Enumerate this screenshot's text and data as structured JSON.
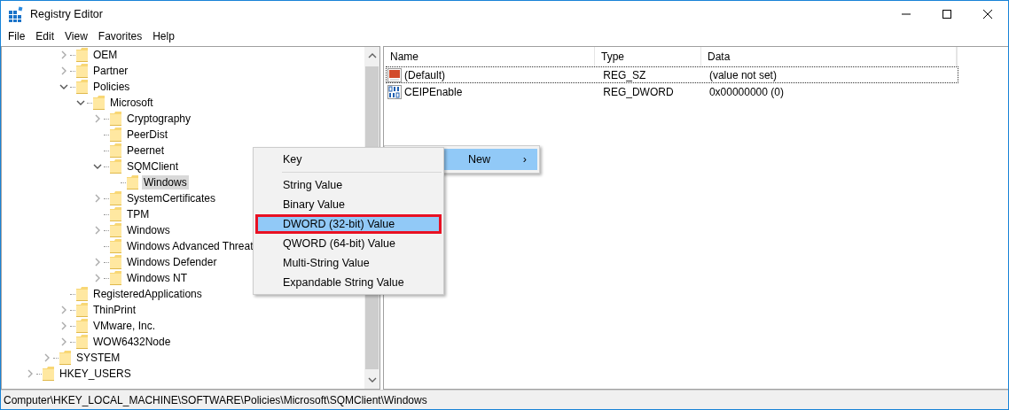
{
  "window": {
    "title": "Registry Editor"
  },
  "menu_bar": [
    "File",
    "Edit",
    "View",
    "Favorites",
    "Help"
  ],
  "tree": {
    "items": [
      {
        "children": [
          {
            "children": [
              {
                "label": "OEM",
                "expanded": false,
                "selected": false
              },
              {
                "label": "Partner",
                "expanded": false,
                "selected": false
              },
              {
                "label": "Policies",
                "expanded": true,
                "selected": false,
                "children": [
                  {
                    "label": "Microsoft",
                    "expanded": true,
                    "selected": false,
                    "children": [
                      {
                        "label": "Cryptography",
                        "expanded": false,
                        "selected": false
                      },
                      {
                        "label": "PeerDist",
                        "selected": false
                      },
                      {
                        "label": "Peernet",
                        "selected": false
                      },
                      {
                        "label": "SQMClient",
                        "expanded": true,
                        "selected": false,
                        "children": [
                          {
                            "label": "Windows",
                            "selected": true
                          }
                        ]
                      },
                      {
                        "label": "SystemCertificates",
                        "expanded": false,
                        "selected": false
                      },
                      {
                        "label": "TPM",
                        "selected": false
                      },
                      {
                        "label": "Windows",
                        "expanded": false,
                        "selected": false
                      },
                      {
                        "label": "Windows Advanced Threat",
                        "selected": false
                      },
                      {
                        "label": "Windows Defender",
                        "expanded": false,
                        "selected": false
                      },
                      {
                        "label": "Windows NT",
                        "expanded": false,
                        "selected": false
                      }
                    ]
                  }
                ]
              },
              {
                "label": "RegisteredApplications",
                "selected": false
              },
              {
                "label": "ThinPrint",
                "expanded": false,
                "selected": false
              },
              {
                "label": "VMware, Inc.",
                "expanded": false,
                "selected": false
              },
              {
                "label": "WOW6432Node",
                "expanded": false,
                "selected": false
              }
            ]
          },
          {
            "label": "SYSTEM",
            "expanded": false,
            "selected": false
          }
        ]
      },
      {
        "label": "HKEY_USERS",
        "expanded": false,
        "selected": false
      }
    ]
  },
  "values": {
    "columns": [
      "Name",
      "Type",
      "Data"
    ],
    "rows": [
      {
        "kind": "string",
        "name": "(Default)",
        "type": "REG_SZ",
        "data": "(value not set)",
        "focused": true
      },
      {
        "kind": "binary",
        "name": "CEIPEnable",
        "type": "REG_DWORD",
        "data": "0x00000000 (0)",
        "focused": false
      }
    ]
  },
  "context_menu": {
    "item": {
      "label": "New",
      "arrow": "›",
      "selected": true
    },
    "submenu": [
      {
        "kind": "item",
        "label": "Key",
        "selected": false,
        "outlined": false
      },
      {
        "kind": "separator"
      },
      {
        "kind": "item",
        "label": "String Value",
        "selected": false,
        "outlined": false
      },
      {
        "kind": "item",
        "label": "Binary Value",
        "selected": false,
        "outlined": false
      },
      {
        "kind": "item",
        "label": "DWORD (32-bit) Value",
        "selected": true,
        "outlined": true
      },
      {
        "kind": "item",
        "label": "QWORD (64-bit) Value",
        "selected": false,
        "outlined": false
      },
      {
        "kind": "item",
        "label": "Multi-String Value",
        "selected": false,
        "outlined": false
      },
      {
        "kind": "item",
        "label": "Expandable String Value",
        "selected": false,
        "outlined": false
      }
    ]
  },
  "status_bar": "Computer\\HKEY_LOCAL_MACHINE\\SOFTWARE\\Policies\\Microsoft\\SQMClient\\Windows"
}
